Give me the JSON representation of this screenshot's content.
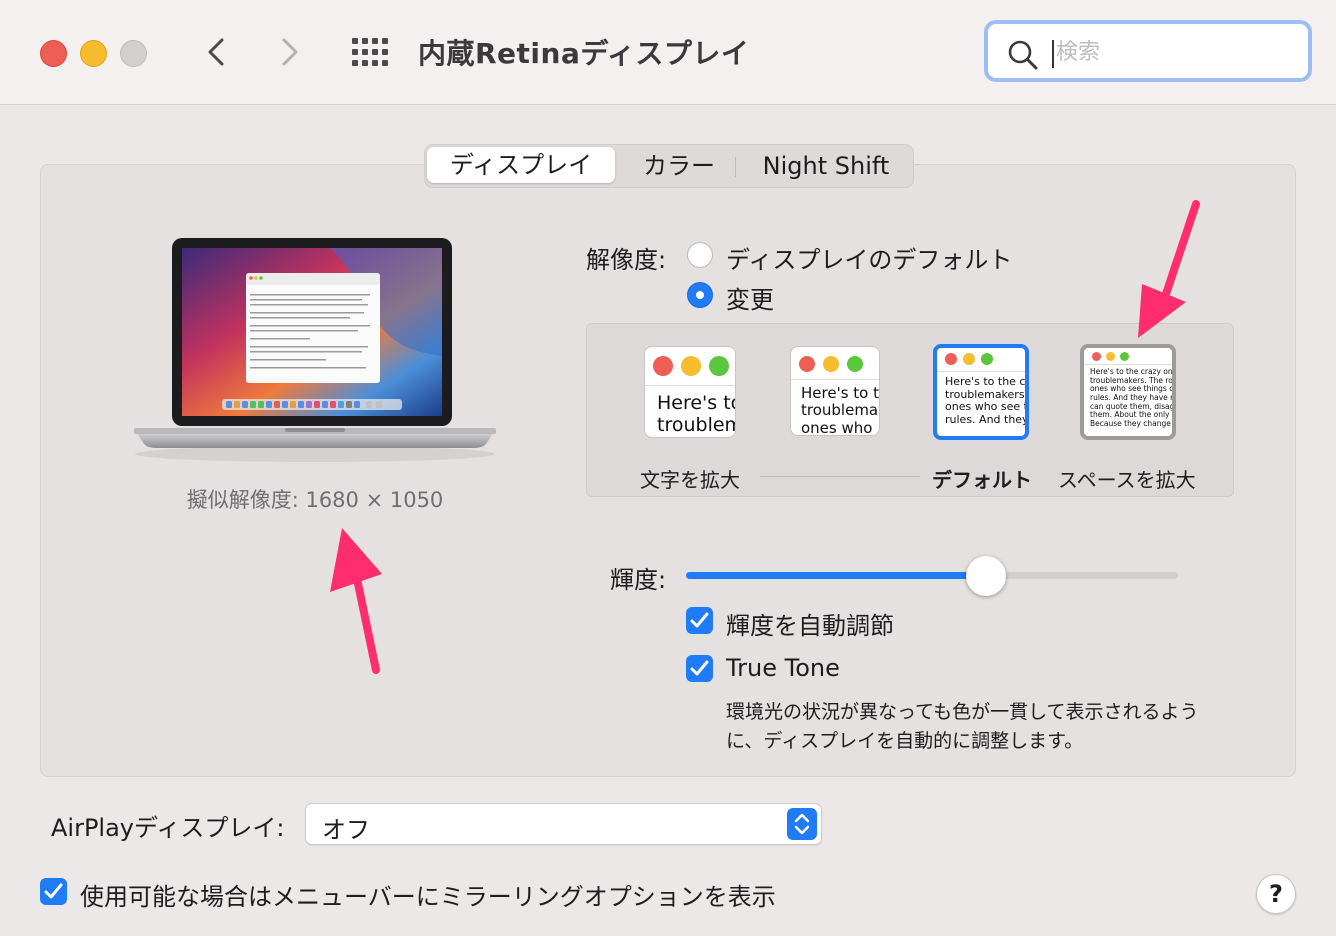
{
  "window": {
    "title": "内蔵Retinaディスプレイ",
    "search_placeholder": "検索"
  },
  "tabs": [
    "ディスプレイ",
    "カラー",
    "Night Shift"
  ],
  "display": {
    "pseudo_resolution": "擬似解像度: 1680 × 1050",
    "resolution_label": "解像度:",
    "resolution_options": [
      {
        "label": "ディスプレイのデフォルト",
        "selected": false
      },
      {
        "label": "変更",
        "selected": true
      }
    ],
    "scale_previews": [
      {
        "text": "Here's to\ntroublem"
      },
      {
        "text": "Here's to t\ntroublema\nones who"
      },
      {
        "text": "Here's to the cr\ntroublemakers.\nones who see t\nrules. And they"
      },
      {
        "text": "Here's to the crazy one\ntroublemakers. The rou\nones who see things dif\nrules. And they have no\ncan quote them, disagre\nthem. About the only th\nBecause they change th"
      }
    ],
    "scale_labels": {
      "larger_text": "文字を拡大",
      "default": "デフォルト",
      "more_space": "スペースを拡大"
    },
    "brightness_label": "輝度:",
    "brightness_level": 0.61,
    "auto_brightness": {
      "label": "輝度を自動調節",
      "checked": true
    },
    "true_tone": {
      "label": "True Tone",
      "checked": true,
      "description": "環境光の状況が異なっても色が一貫して表示されるように、ディスプレイを自動的に調整します。"
    }
  },
  "airplay": {
    "label": "AirPlayディスプレイ:",
    "value": "オフ"
  },
  "mirroring": {
    "label": "使用可能な場合はメニューバーにミラーリングオプションを表示",
    "checked": true
  },
  "help": {
    "label": "?"
  },
  "colors": {
    "accent": "#1F7BF6",
    "annotation_arrow": "#FF2D6F",
    "close": "#EE5E55",
    "minimize": "#F5BC2E"
  }
}
